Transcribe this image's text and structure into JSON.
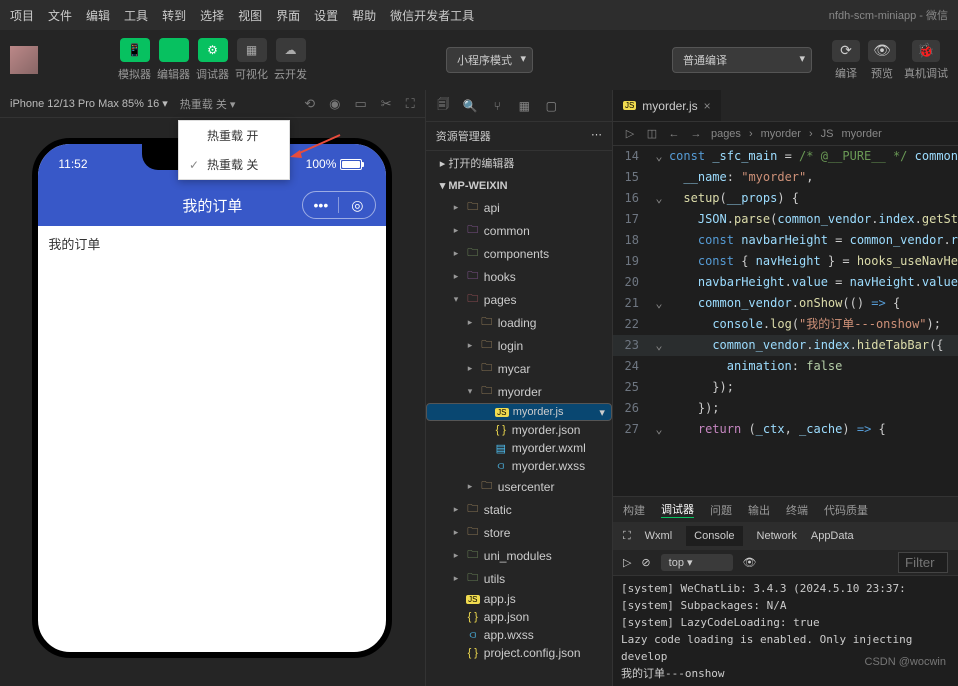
{
  "window": {
    "title": "nfdh-scm-miniapp - 微信"
  },
  "menu": [
    "项目",
    "文件",
    "编辑",
    "工具",
    "转到",
    "选择",
    "视图",
    "界面",
    "设置",
    "帮助",
    "微信开发者工具"
  ],
  "toolbar": {
    "items": [
      {
        "icon": "📱",
        "label": "模拟器"
      },
      {
        "icon": "</>",
        "label": "编辑器"
      },
      {
        "icon": "⚙",
        "label": "调试器"
      },
      {
        "icon": "▦",
        "label": "可视化"
      },
      {
        "icon": "☁",
        "label": "云开发"
      }
    ],
    "mode_label": "小程序模式",
    "compile_label": "普通编译",
    "right": [
      {
        "icon": "⟳",
        "label": "编译"
      },
      {
        "icon": "👁",
        "label": "预览"
      },
      {
        "icon": "🐞",
        "label": "真机调试"
      }
    ]
  },
  "sim": {
    "device": "iPhone 12/13 Pro Max 85% 16",
    "reload": "热重载 关",
    "dropdown": [
      "热重载 开",
      "热重载 关"
    ],
    "status_time": "11:52",
    "status_batt": "100%",
    "app_title": "我的订单",
    "body": "我的订单"
  },
  "explorer": {
    "title": "资源管理器",
    "opened": "打开的编辑器",
    "project": "MP-WEIXIN",
    "tree": [
      {
        "d": 2,
        "t": "folder",
        "n": "api",
        "c": "folder"
      },
      {
        "d": 2,
        "t": "folder",
        "n": "common",
        "c": "folder-p"
      },
      {
        "d": 2,
        "t": "folder",
        "n": "components",
        "c": "folder-g"
      },
      {
        "d": 2,
        "t": "folder",
        "n": "hooks",
        "c": "folder-p"
      },
      {
        "d": 2,
        "t": "folder-open",
        "n": "pages",
        "c": "folder-r"
      },
      {
        "d": 3,
        "t": "folder",
        "n": "loading",
        "c": "folder"
      },
      {
        "d": 3,
        "t": "folder",
        "n": "login",
        "c": "folder"
      },
      {
        "d": 3,
        "t": "folder",
        "n": "mycar",
        "c": "folder"
      },
      {
        "d": 3,
        "t": "folder-open",
        "n": "myorder",
        "c": "folder"
      },
      {
        "d": 4,
        "t": "file",
        "n": "myorder.js",
        "c": "js",
        "sel": true
      },
      {
        "d": 4,
        "t": "file",
        "n": "myorder.json",
        "c": "json"
      },
      {
        "d": 4,
        "t": "file",
        "n": "myorder.wxml",
        "c": "wxml"
      },
      {
        "d": 4,
        "t": "file",
        "n": "myorder.wxss",
        "c": "wxss"
      },
      {
        "d": 3,
        "t": "folder",
        "n": "usercenter",
        "c": "folder"
      },
      {
        "d": 2,
        "t": "folder",
        "n": "static",
        "c": "folder"
      },
      {
        "d": 2,
        "t": "folder",
        "n": "store",
        "c": "folder"
      },
      {
        "d": 2,
        "t": "folder",
        "n": "uni_modules",
        "c": "folder-g"
      },
      {
        "d": 2,
        "t": "folder",
        "n": "utils",
        "c": "folder-g"
      },
      {
        "d": 2,
        "t": "file",
        "n": "app.js",
        "c": "js"
      },
      {
        "d": 2,
        "t": "file",
        "n": "app.json",
        "c": "json"
      },
      {
        "d": 2,
        "t": "file",
        "n": "app.wxss",
        "c": "wxss"
      },
      {
        "d": 2,
        "t": "file",
        "n": "project.config.json",
        "c": "json"
      }
    ]
  },
  "editor": {
    "tab": "myorder.js",
    "crumb": [
      "pages",
      "myorder",
      "myorder"
    ],
    "lines": [
      {
        "n": 14,
        "g": "⌄",
        "h": "<span class=k>const</span> <span class=v>_sfc_main</span> = <span class=c>/* @__PURE__ */</span> <span class=v>common</span>"
      },
      {
        "n": 15,
        "g": "",
        "h": "  <span class=v>__name</span>: <span class=s>\"myorder\"</span>,"
      },
      {
        "n": 16,
        "g": "⌄",
        "h": "  <span class=f>setup</span>(<span class=v>__props</span>) {"
      },
      {
        "n": 17,
        "g": "",
        "h": "    <span class=v>JSON</span>.<span class=f>parse</span>(<span class=v>common_vendor</span>.<span class=v>index</span>.<span class=f>getSt</span>"
      },
      {
        "n": 18,
        "g": "",
        "h": "    <span class=k>const</span> <span class=v>navbarHeight</span> = <span class=v>common_vendor</span>.<span class=v>r</span>"
      },
      {
        "n": 19,
        "g": "",
        "h": "    <span class=k>const</span> { <span class=v>navHeight</span> } = <span class=f>hooks_useNavHe</span>"
      },
      {
        "n": 20,
        "g": "",
        "h": "    <span class=v>navbarHeight</span>.<span class=v>value</span> = <span class=v>navHeight</span>.<span class=v>value</span>"
      },
      {
        "n": 21,
        "g": "⌄",
        "h": "    <span class=v>common_vendor</span>.<span class=f>onShow</span>(() <span class=k>=&gt;</span> {"
      },
      {
        "n": 22,
        "g": "",
        "h": "      <span class=v>console</span>.<span class=f>log</span>(<span class=s>\"我的订单---onshow\"</span>);"
      },
      {
        "n": 23,
        "g": "⌄",
        "h": "      <span class=v>common_vendor</span>.<span class=v>index</span>.<span class=f>hideTabBar</span>({",
        "hl": true
      },
      {
        "n": 24,
        "g": "",
        "h": "        <span class=v>animation</span>: <span class=n>false</span>"
      },
      {
        "n": 25,
        "g": "",
        "h": "      });"
      },
      {
        "n": 26,
        "g": "",
        "h": "    });"
      },
      {
        "n": 27,
        "g": "⌄",
        "h": "    <span class=p>return</span> (<span class=v>_ctx</span>, <span class=v>_cache</span>) <span class=k>=&gt;</span> {"
      }
    ]
  },
  "bottom_tabs": [
    "构建",
    "调试器",
    "问题",
    "输出",
    "终端",
    "代码质量"
  ],
  "dbg_tabs": [
    "Wxml",
    "Console",
    "Network",
    "AppData"
  ],
  "dbg_bar": {
    "top": "top",
    "filter": "Filter"
  },
  "console": [
    "[system] WeChatLib: 3.4.3 (2024.5.10 23:37:",
    "[system] Subpackages: N/A",
    "[system] LazyCodeLoading: true",
    "Lazy code loading is enabled. Only injecting",
    "develop",
    "我的订单---onshow"
  ],
  "watermark": "CSDN @wocwin"
}
